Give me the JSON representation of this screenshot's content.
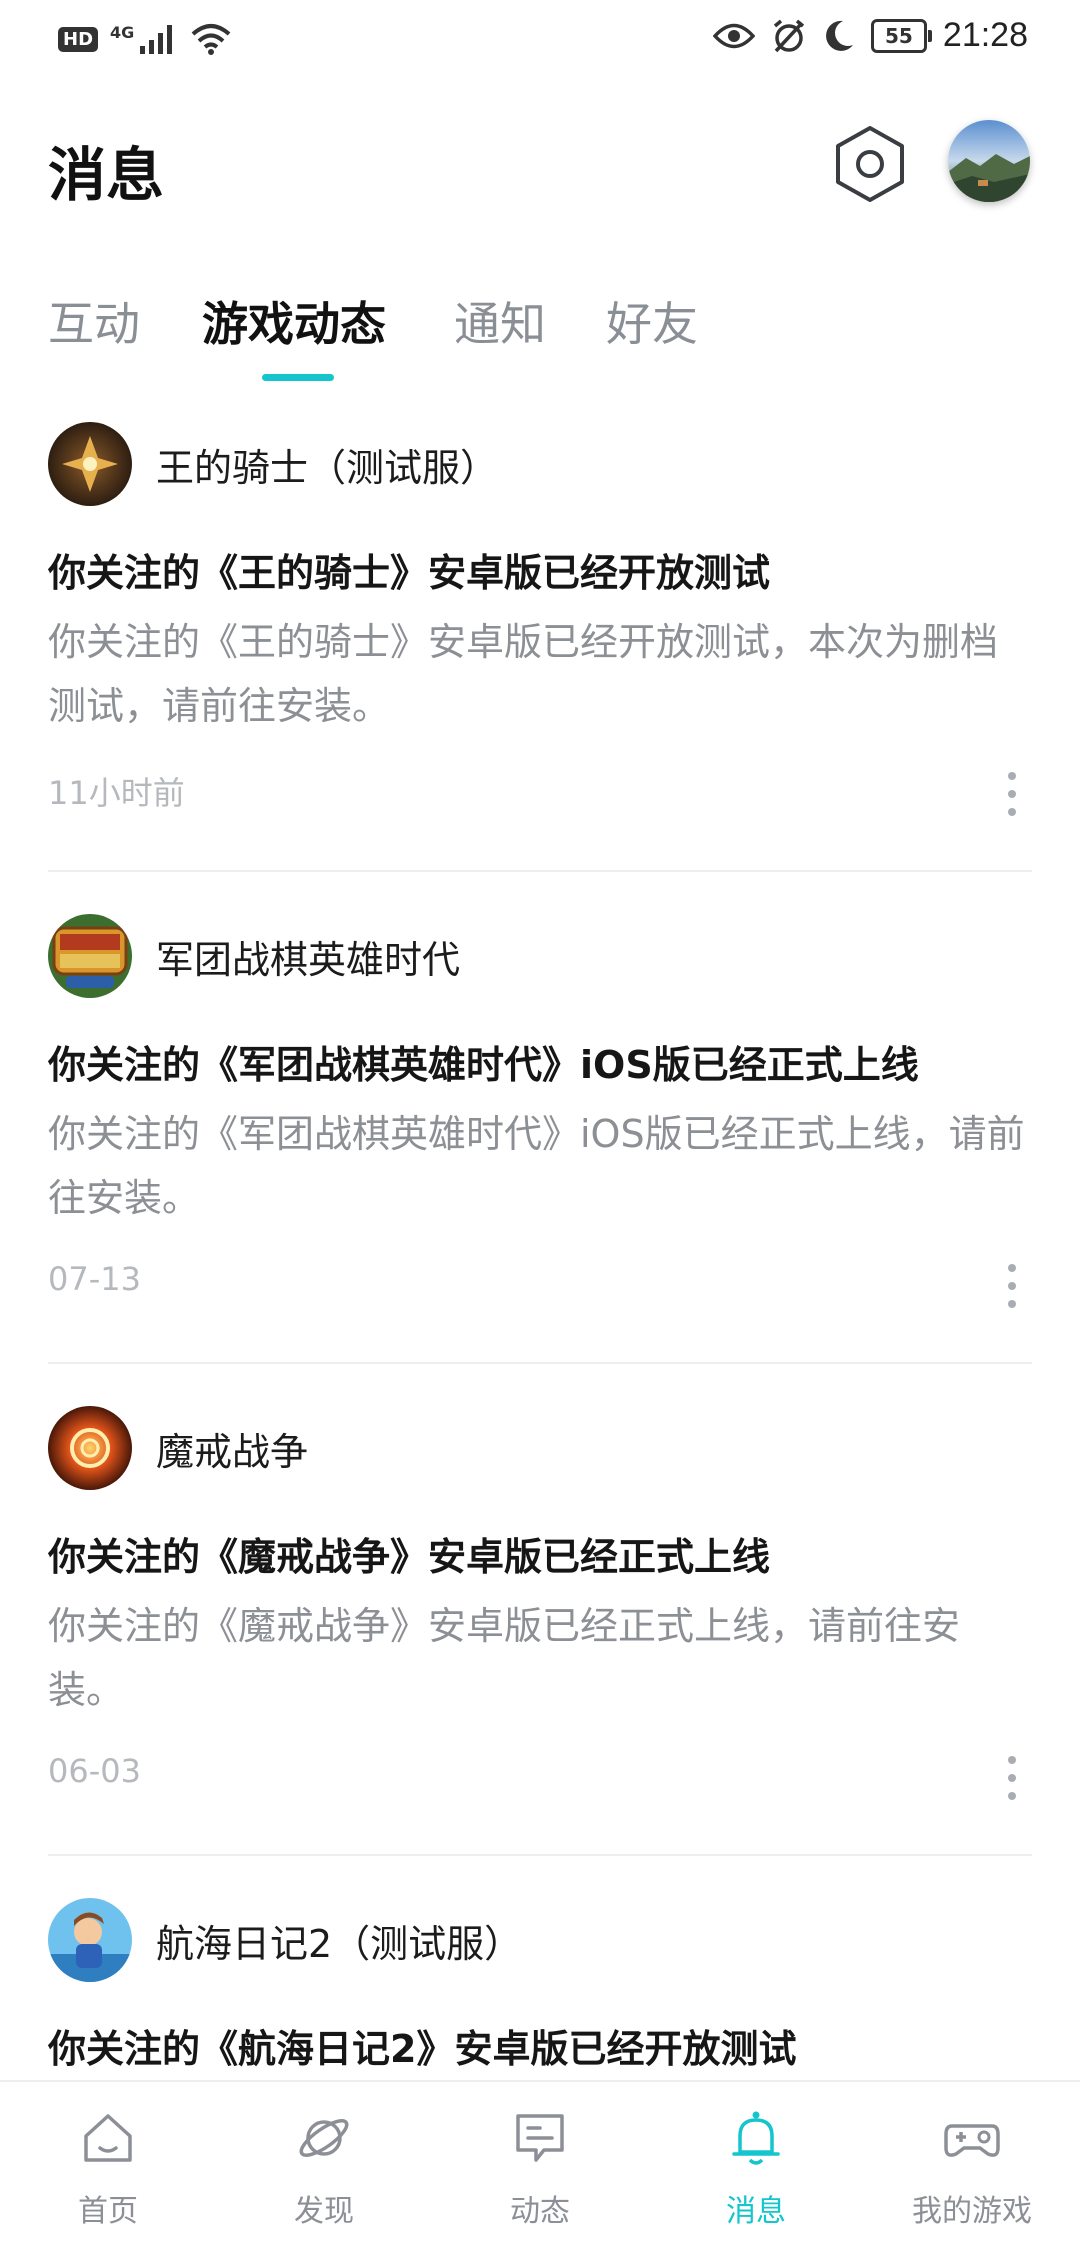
{
  "status_bar": {
    "hd": "HD",
    "network": "4G",
    "battery": "55",
    "time": "21:28"
  },
  "header": {
    "title": "消息"
  },
  "tabs": [
    {
      "label": "互动",
      "active": false
    },
    {
      "label": "游戏动态",
      "active": true
    },
    {
      "label": "通知",
      "active": false
    },
    {
      "label": "好友",
      "active": false
    }
  ],
  "feed": [
    {
      "game": "王的骑士（测试服）",
      "icon": "knight-emblem-icon",
      "title": "你关注的《王的骑士》安卓版已经开放测试",
      "body": "你关注的《王的骑士》安卓版已经开放测试，本次为删档测试，请前往安装。",
      "time": "11小时前"
    },
    {
      "game": "军团战棋英雄时代",
      "icon": "legion-chess-icon",
      "title": "你关注的《军团战棋英雄时代》iOS版已经正式上线",
      "body": "你关注的《军团战棋英雄时代》iOS版已经正式上线，请前往安装。",
      "time": "07-13"
    },
    {
      "game": "魔戒战争",
      "icon": "magic-ring-icon",
      "title": "你关注的《魔戒战争》安卓版已经正式上线",
      "body": "你关注的《魔戒战争》安卓版已经正式上线，请前往安装。",
      "time": "06-03"
    },
    {
      "game": "航海日记2（测试服）",
      "icon": "sailing-diary-icon",
      "title": "你关注的《航海日记2》安卓版已经开放测试"
    }
  ],
  "bottom_nav": [
    {
      "label": "首页",
      "icon": "home-icon",
      "active": false
    },
    {
      "label": "发现",
      "icon": "planet-icon",
      "active": false
    },
    {
      "label": "动态",
      "icon": "chat-bubble-icon",
      "active": false
    },
    {
      "label": "消息",
      "icon": "bell-icon",
      "active": true
    },
    {
      "label": "我的游戏",
      "icon": "gamepad-icon",
      "active": false
    }
  ],
  "colors": {
    "accent": "#15c5ce",
    "text_primary": "#161616",
    "text_secondary": "#8c8f94",
    "text_time": "#b5b8bd",
    "tab_inactive": "#8a8f96"
  }
}
